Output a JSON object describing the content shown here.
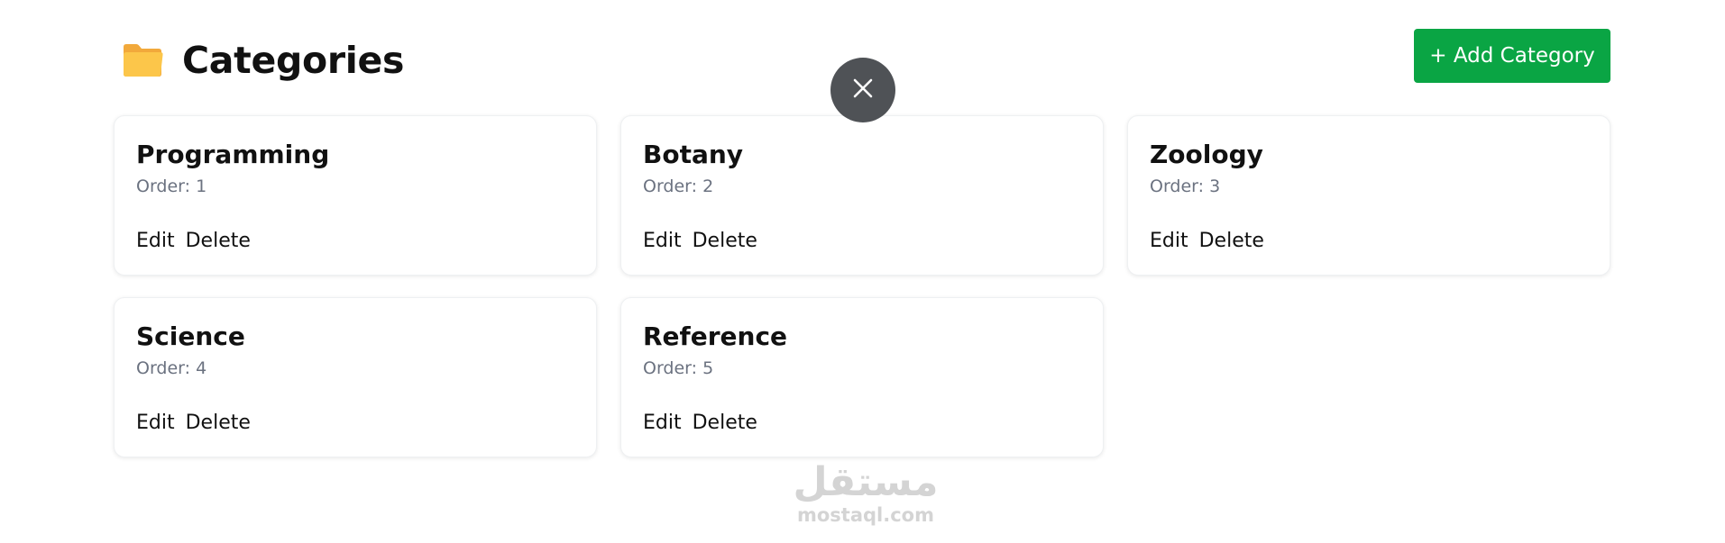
{
  "header": {
    "title": "Categories",
    "title_icon": "folder-icon",
    "add_button_label": "+ Add Category"
  },
  "overlay": {
    "close_icon": "close-icon"
  },
  "categories": [
    {
      "name": "Programming",
      "order_text": "Order: 1",
      "edit_label": "Edit",
      "delete_label": "Delete"
    },
    {
      "name": "Botany",
      "order_text": "Order: 2",
      "edit_label": "Edit",
      "delete_label": "Delete"
    },
    {
      "name": "Zoology",
      "order_text": "Order: 3",
      "edit_label": "Edit",
      "delete_label": "Delete"
    },
    {
      "name": "Science",
      "order_text": "Order: 4",
      "edit_label": "Edit",
      "delete_label": "Delete"
    },
    {
      "name": "Reference",
      "order_text": "Order: 5",
      "edit_label": "Edit",
      "delete_label": "Delete"
    }
  ],
  "watermark": {
    "logo_text": "مستقل",
    "domain": "mostaql.com"
  },
  "colors": {
    "accent_green": "#0aa544",
    "close_button_bg": "#4f5256",
    "folder_yellow": "#fcc64a",
    "muted_text": "#6b7280"
  }
}
